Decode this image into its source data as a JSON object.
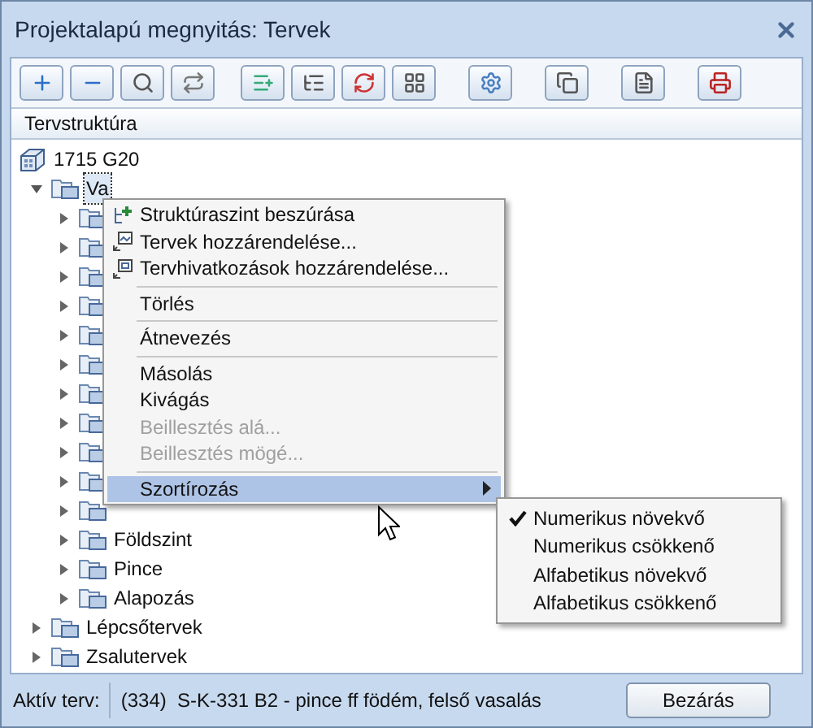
{
  "window": {
    "title": "Projektalapú megnyitás: Tervek"
  },
  "tree_header": {
    "label": "Tervstruktúra"
  },
  "tree": [
    {
      "kind": "project",
      "label": "1715 G20",
      "children": [
        {
          "kind": "folder",
          "label": "Va",
          "expanded": true,
          "selected": true,
          "children": [
            {
              "kind": "folder",
              "expanded": false
            },
            {
              "kind": "folder",
              "expanded": false
            },
            {
              "kind": "folder",
              "expanded": false
            },
            {
              "kind": "folder",
              "expanded": false
            },
            {
              "kind": "folder",
              "expanded": false
            },
            {
              "kind": "folder",
              "expanded": false
            },
            {
              "kind": "folder",
              "expanded": false
            },
            {
              "kind": "folder",
              "expanded": false
            },
            {
              "kind": "folder",
              "expanded": false
            },
            {
              "kind": "folder",
              "expanded": false
            },
            {
              "kind": "folder",
              "expanded": false
            },
            {
              "kind": "folder",
              "label": "Földszint",
              "expanded": false
            },
            {
              "kind": "folder",
              "label": "Pince",
              "expanded": false
            },
            {
              "kind": "folder",
              "label": "Alapozás",
              "expanded": false
            }
          ]
        },
        {
          "kind": "folder",
          "label": "Lépcsőtervek",
          "expanded": false
        },
        {
          "kind": "folder",
          "label": "Zsalutervek",
          "expanded": false
        }
      ]
    }
  ],
  "context_menu": {
    "items": [
      {
        "kind": "command",
        "label": "Struktúraszint beszúrása",
        "disabled": false,
        "selected": false
      },
      {
        "kind": "command",
        "label": "Tervek hozzárendelése...",
        "disabled": false,
        "selected": false
      },
      {
        "kind": "command",
        "label": "Tervhivatkozások hozzárendelése...",
        "disabled": false,
        "selected": false
      },
      {
        "kind": "separator"
      },
      {
        "kind": "command",
        "label": "Törlés",
        "disabled": false,
        "selected": false
      },
      {
        "kind": "separator"
      },
      {
        "kind": "command",
        "label": "Átnevezés",
        "disabled": false,
        "selected": false
      },
      {
        "kind": "separator"
      },
      {
        "kind": "command",
        "label": "Másolás",
        "disabled": false,
        "selected": false
      },
      {
        "kind": "command",
        "label": "Kivágás",
        "disabled": false,
        "selected": false
      },
      {
        "kind": "command",
        "label": "Beillesztés alá...",
        "disabled": true,
        "selected": false
      },
      {
        "kind": "command",
        "label": "Beillesztés mögé...",
        "disabled": true,
        "selected": false
      },
      {
        "kind": "separator"
      },
      {
        "kind": "submenu",
        "label": "Szortírozás",
        "disabled": false,
        "selected": true
      }
    ]
  },
  "submenu": {
    "items": [
      {
        "label": "Numerikus növekvő",
        "checked": true
      },
      {
        "label": "Numerikus csökkenő",
        "checked": false
      },
      {
        "label": "Alfabetikus növekvő",
        "checked": false
      },
      {
        "label": "Alfabetikus csökkenő",
        "checked": false
      }
    ]
  },
  "status_bar": {
    "label": "Aktív terv:",
    "value": "(334)  S-K-331 B2 - pince ff födém, felső vasalás",
    "button": "Bezárás"
  }
}
